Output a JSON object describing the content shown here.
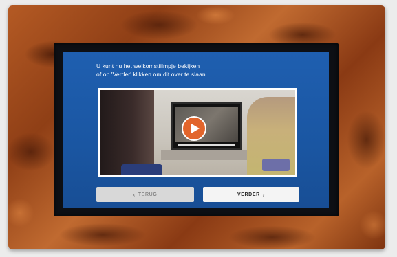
{
  "screen": {
    "instructions": {
      "line1": "U kunt nu het welkomstfilmpje bekijken",
      "line2": "of op 'Verder' klikken om dit over te slaan"
    },
    "video": {
      "play_icon": "play-icon"
    },
    "buttons": {
      "back_label": "TERUG",
      "back_chevron": "‹",
      "next_label": "VERDER",
      "next_chevron": "›"
    }
  },
  "colors": {
    "screen_background": "#1f5fb0",
    "play_button": "#e2652c",
    "frame_wood": "#b45a24"
  }
}
